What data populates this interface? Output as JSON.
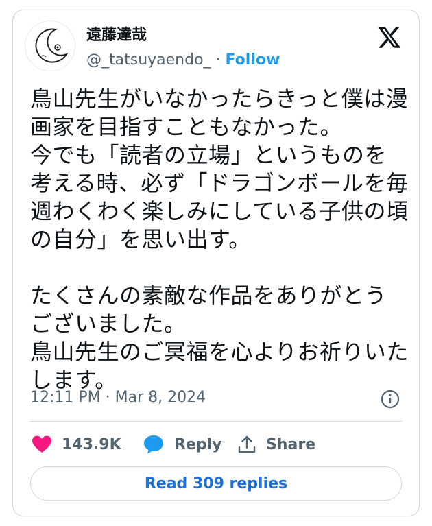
{
  "author": {
    "display_name": "遠藤達哉",
    "handle": "@_tatsuyaendo_",
    "separator": "·",
    "follow_label": "Follow"
  },
  "tweet": {
    "paragraphs": [
      "鳥山先生がいなかったらきっと僕は漫\n画家を目指すこともなかった。\n今でも「読者の立場」というものを\n考える時、必ず「ドラゴンボールを毎\n週わくわく楽しみにしている子供の頃\nの自分」を思い出す。",
      "たくさんの素敵な作品をありがとう\nございました。\n鳥山先生のご冥福を心よりお祈りいた\nします。"
    ],
    "timestamp": "12:11 PM · Mar 8, 2024"
  },
  "actions": {
    "likes_count": "143.9K",
    "reply_label": "Reply",
    "share_label": "Share",
    "read_replies_label": "Read 309 replies"
  },
  "icons": {
    "brand": "x-logo-icon",
    "info": "info-icon",
    "like": "heart-icon",
    "reply": "speech-bubble-icon",
    "share": "share-icon"
  },
  "colors": {
    "like": "#f91880",
    "reply": "#1d9bf0",
    "follow": "#1d9bf0",
    "read_replies": "#1d6fd6",
    "secondary_text": "#536471",
    "border": "#cfd9de"
  }
}
